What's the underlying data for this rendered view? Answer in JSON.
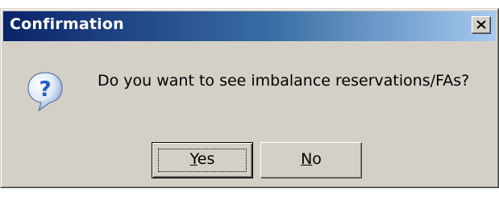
{
  "window": {
    "title": "Confirmation",
    "close_icon": "close-icon"
  },
  "message": {
    "icon": "question-icon",
    "text": "Do you want to see imbalance reservations/FAs?"
  },
  "buttons": {
    "yes": {
      "first": "Y",
      "rest": "es"
    },
    "no": {
      "first": "N",
      "rest": "o"
    }
  },
  "colors": {
    "titlebar_start": "#0a246a",
    "titlebar_end": "#a6caf0",
    "dialog_face": "#d4d0c8",
    "icon_blue": "#2f6fd0"
  }
}
